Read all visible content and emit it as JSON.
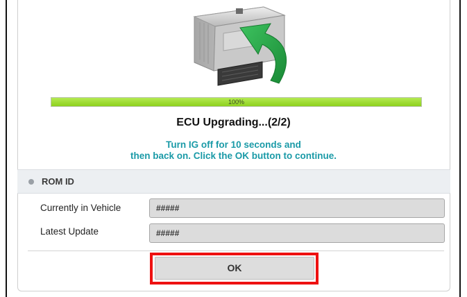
{
  "progress": {
    "percent_label": "100%",
    "value": 1.0
  },
  "status": {
    "title": "ECU Upgrading...(2/2)"
  },
  "instructions": {
    "line1": "Turn IG off for 10 seconds and",
    "line2": "then back on. Click the OK button to continue."
  },
  "rom_section": {
    "title": "ROM ID",
    "fields": [
      {
        "label": "Currently in Vehicle",
        "value": "#####"
      },
      {
        "label": "Latest Update",
        "value": "#####"
      }
    ]
  },
  "actions": {
    "ok_label": "OK"
  },
  "colors": {
    "progress_fill": "#98d82a",
    "instruction_text": "#1a9aa7",
    "highlight": "#ee1111",
    "arrow": "#2aa84a"
  },
  "icons": {
    "illustration": "ecu-module-with-arrow-icon"
  }
}
